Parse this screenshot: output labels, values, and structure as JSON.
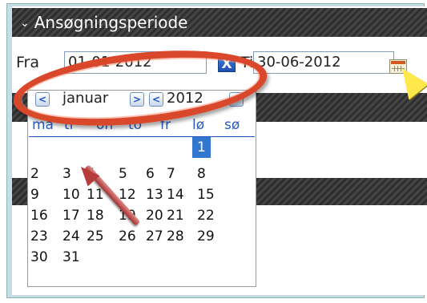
{
  "section": {
    "title": "Ansøgningsperiode"
  },
  "period": {
    "from_label": "Fra",
    "from_value": "01-01-2012",
    "to_label": "Til",
    "to_value": "30-06-2012",
    "clear_glyph": "X"
  },
  "calendar": {
    "month": "januar",
    "year": "2012",
    "prev_glyph": "<",
    "next_glyph": ">",
    "weekdays": [
      "ma",
      "ti",
      "on",
      "to",
      "fr",
      "lø",
      "sø"
    ],
    "selected_day": "1",
    "weeks": [
      [
        "",
        "",
        "",
        "",
        "",
        "",
        "1"
      ],
      [
        "2",
        "3",
        "4",
        "5",
        "6",
        "7",
        "8"
      ],
      [
        "9",
        "10",
        "11",
        "12",
        "13",
        "14",
        "15"
      ],
      [
        "16",
        "17",
        "18",
        "19",
        "20",
        "21",
        "22"
      ],
      [
        "23",
        "24",
        "25",
        "26",
        "27",
        "28",
        "29"
      ],
      [
        "30",
        "31",
        "",
        "",
        "",
        "",
        ""
      ]
    ]
  },
  "colors": {
    "annotation": "#d9482a",
    "selected": "#3276d0",
    "header": "#3b3b3b"
  }
}
